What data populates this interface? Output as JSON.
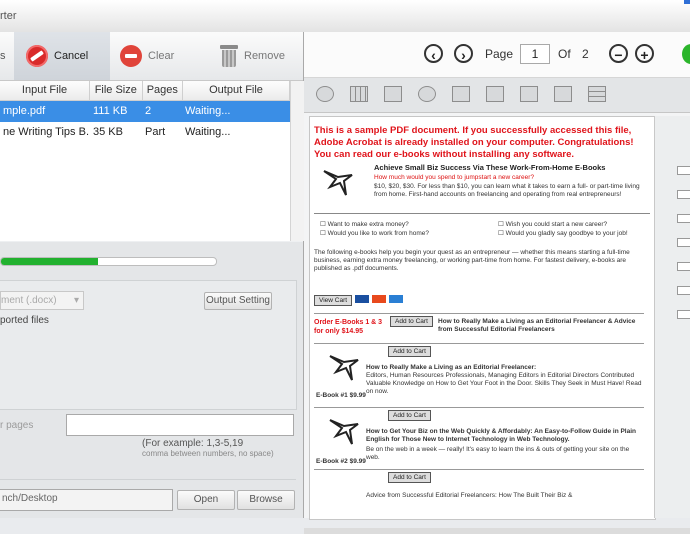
{
  "window": {
    "title_fragment": "rter"
  },
  "toolbar": {
    "cancel": "Cancel",
    "clear": "Clear",
    "remove": "Remove"
  },
  "table": {
    "headers": [
      "Input File",
      "File Size",
      "Pages",
      "Output File"
    ],
    "rows": [
      {
        "input": "mple.pdf",
        "size": "111 KB",
        "pages": "2",
        "output": "Waiting..."
      },
      {
        "input": "ne Writing Tips B...",
        "size": "35 KB",
        "pages": "Part",
        "output": "Waiting..."
      }
    ]
  },
  "progress": {
    "value": 0.45
  },
  "options": {
    "format_value": "ment (.docx)",
    "output_setting": "Output Setting",
    "ported_files": "ported files",
    "range_label": "r pages",
    "example": "(For example: 1,3-5,19",
    "example2": "comma between numbers, no space)",
    "path_value": "nch/Desktop",
    "open": "Open",
    "browse": "Browse"
  },
  "viewer": {
    "page_label": "Page",
    "page": "1",
    "of_label": "Of",
    "total": "2"
  },
  "pdf": {
    "head_red": "This is a sample PDF document. If you successfully accessed this file, Adobe Acrobat is already installed on your computer. Congratulations! You can read our e-books without installing any software.",
    "promo_title": "Achieve Small Biz Success Via These Work-From-Home E-Books",
    "promo_red": "How much would you spend to jumpstart a new career?",
    "promo_text": "$10, $20, $30. For less than $10, you can learn what it takes to earn a full- or part-time living from home. First-hand accounts on freelancing and operating from real entrepreneurs!",
    "bullets": [
      "Want to make extra money?",
      "Would you like to work from home?",
      "Wish you could start a new career?",
      "Would you gladly say goodbye to your job!"
    ],
    "intro": "The following e-books help you begin your quest as an entrepreneur — whether this means starting a full-time business, earning extra money freelancing, or working part-time from home. For fastest delivery, e-books are published as .pdf documents.",
    "order_red": "Order E-Books 1 & 3 for only $14.95",
    "add_cart": "Add to Cart",
    "view_cart": "View Cart",
    "book0": "How to Really Make a Living as an Editorial Freelancer & Advice from Successful Editorial Freelancers",
    "book1_title": "How to Really Make a Living as an Editorial Freelancer:",
    "book1_text": "Editors, Human Resources Professionals, Managing Editors in Editorial Directors Contributed Valuable Knowledge on How to Get Your Foot in the Door. Skills They Seek in Must Have! Read on now.",
    "ebook1": "E-Book #1  $9.99",
    "book2_title": "How to Get Your Biz on the Web Quickly & Affordably: An Easy-to-Follow Guide in Plain English for Those New to Internet Technology in Web Technology.",
    "book2_text": "Be on the web in a week — really! It's easy to learn the ins & outs of getting your site on the web.",
    "ebook2": "E-Book #2  $9.99",
    "book3_text": "Advice from Successful Editorial Freelancers: How The Built Their Biz &"
  }
}
